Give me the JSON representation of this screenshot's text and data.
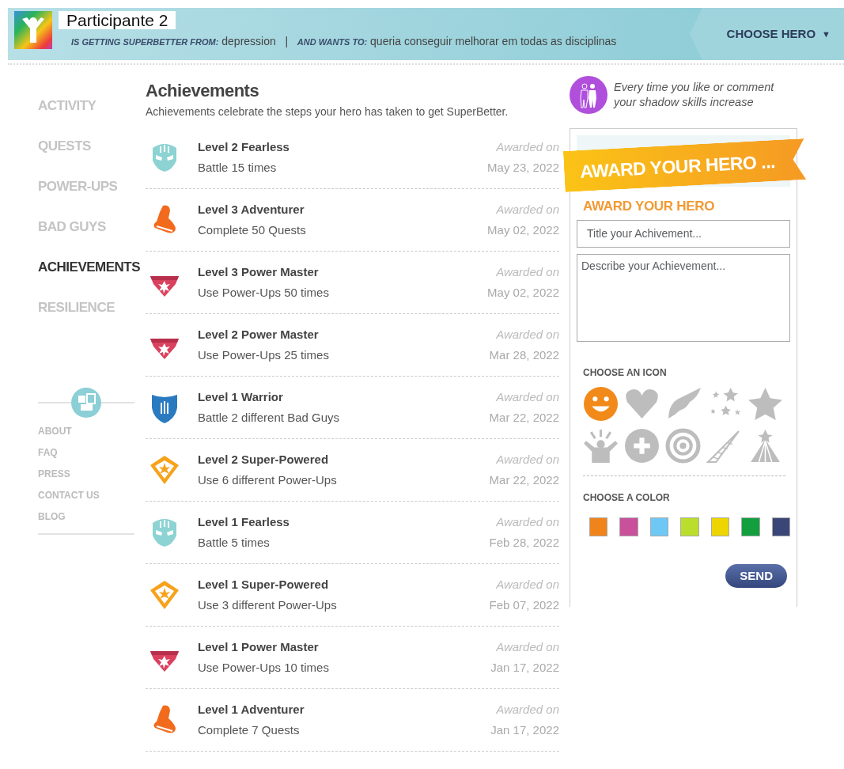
{
  "header": {
    "hero_name": "Participante 2",
    "from_label": "IS GETTING SUPERBETTER FROM:",
    "from_value": "depression",
    "separator": "|",
    "wants_label": "AND WANTS TO:",
    "wants_value": "queria conseguir melhorar em todas as disciplinas",
    "choose_hero": "CHOOSE HERO",
    "caret": "▼"
  },
  "sidebar": {
    "items": [
      {
        "label": "ACTIVITY",
        "selected": false
      },
      {
        "label": "QUESTS",
        "selected": false
      },
      {
        "label": "POWER-UPS",
        "selected": false
      },
      {
        "label": "BAD GUYS",
        "selected": false
      },
      {
        "label": "ACHIEVEMENTS",
        "selected": true
      },
      {
        "label": "RESILIENCE",
        "selected": false
      }
    ],
    "links": [
      "ABOUT",
      "FAQ",
      "PRESS",
      "CONTACT US",
      "BLOG"
    ]
  },
  "achievements": {
    "title": "Achievements",
    "subtitle": "Achievements celebrate the steps your hero has taken to get SuperBetter.",
    "items": [
      {
        "kind": "fearless",
        "name": "Level 2 Fearless",
        "desc": "Battle 15 times",
        "awarded": "Awarded on",
        "date": "May 23, 2022"
      },
      {
        "kind": "adventurer",
        "name": "Level 3 Adventurer",
        "desc": "Complete 50 Quests",
        "awarded": "Awarded on",
        "date": "May 02, 2022"
      },
      {
        "kind": "power",
        "name": "Level 3 Power Master",
        "desc": "Use Power-Ups 50 times",
        "awarded": "Awarded on",
        "date": "May 02, 2022"
      },
      {
        "kind": "power",
        "name": "Level 2 Power Master",
        "desc": "Use Power-Ups 25 times",
        "awarded": "Awarded on",
        "date": "Mar 28, 2022"
      },
      {
        "kind": "warrior",
        "name": "Level 1 Warrior",
        "desc": "Battle 2 different Bad Guys",
        "awarded": "Awarded on",
        "date": "Mar 22, 2022"
      },
      {
        "kind": "super",
        "name": "Level 2 Super-Powered",
        "desc": "Use 6 different Power-Ups",
        "awarded": "Awarded on",
        "date": "Mar 22, 2022"
      },
      {
        "kind": "fearless",
        "name": "Level 1 Fearless",
        "desc": "Battle 5 times",
        "awarded": "Awarded on",
        "date": "Feb 28, 2022"
      },
      {
        "kind": "super",
        "name": "Level 1 Super-Powered",
        "desc": "Use 3 different Power-Ups",
        "awarded": "Awarded on",
        "date": "Feb 07, 2022"
      },
      {
        "kind": "power",
        "name": "Level 1 Power Master",
        "desc": "Use Power-Ups 10 times",
        "awarded": "Awarded on",
        "date": "Jan 17, 2022"
      },
      {
        "kind": "adventurer",
        "name": "Level 1 Adventurer",
        "desc": "Complete 7 Quests",
        "awarded": "Awarded on",
        "date": "Jan 17, 2022"
      }
    ]
  },
  "shadow_tip": "Every time you like or comment your shadow skills increase",
  "award_panel": {
    "banner": "AWARD YOUR HERO ...",
    "heading": "AWARD YOUR HERO",
    "title_placeholder": "Title your Achivement...",
    "desc_placeholder": "Describe your Achievement...",
    "icon_label": "CHOOSE AN ICON",
    "icons": [
      {
        "kind": "smiley",
        "selected": true
      },
      {
        "kind": "heart",
        "selected": false
      },
      {
        "kind": "wing",
        "selected": false
      },
      {
        "kind": "stars",
        "selected": false
      },
      {
        "kind": "star",
        "selected": false
      },
      {
        "kind": "cheer",
        "selected": false
      },
      {
        "kind": "plus",
        "selected": false
      },
      {
        "kind": "target",
        "selected": false
      },
      {
        "kind": "horn",
        "selected": false
      },
      {
        "kind": "tent",
        "selected": false
      }
    ],
    "color_label": "CHOOSE A COLOR",
    "colors": [
      {
        "color": "#f0841a",
        "selected": false
      },
      {
        "color": "#c9509b",
        "selected": false
      },
      {
        "color": "#6ec8f5",
        "selected": false
      },
      {
        "color": "#bbdd2c",
        "selected": false
      },
      {
        "color": "#eed500",
        "selected": false
      },
      {
        "color": "#139f3e",
        "selected": false
      },
      {
        "color": "#3a4677",
        "selected": false
      }
    ],
    "send": "SEND"
  }
}
